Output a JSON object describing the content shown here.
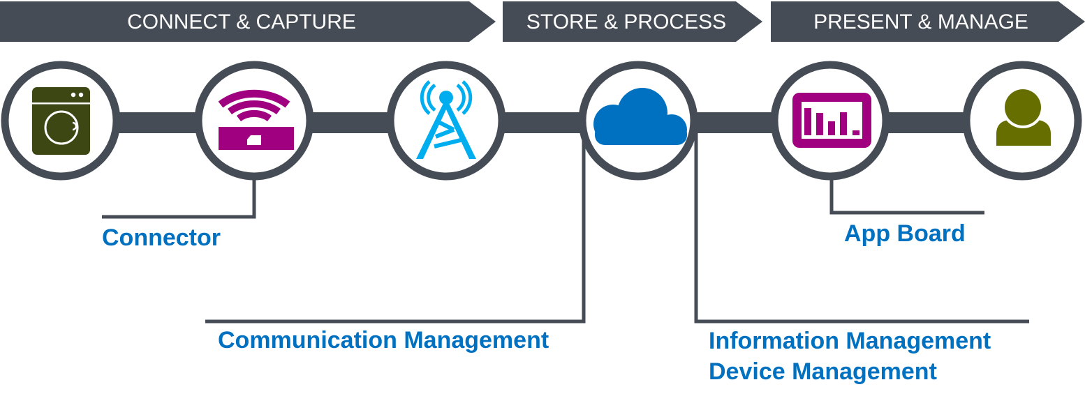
{
  "colors": {
    "banner": "#454c55",
    "connector_line": "#454c55",
    "label_text": "#0070c0",
    "washer_icon": "#3d4714",
    "router_icon": "#a0007f",
    "tower_icon": "#00aeef",
    "cloud_icon": "#0071c1",
    "dashboard_icon": "#a0007f",
    "user_icon": "#666e00"
  },
  "stages": [
    {
      "label": "CONNECT & CAPTURE"
    },
    {
      "label": "STORE & PROCESS"
    },
    {
      "label": "PRESENT & MANAGE"
    }
  ],
  "nodes": [
    {
      "icon": "washing-machine-icon"
    },
    {
      "icon": "wifi-router-icon"
    },
    {
      "icon": "cell-tower-icon"
    },
    {
      "icon": "cloud-icon"
    },
    {
      "icon": "dashboard-chart-icon"
    },
    {
      "icon": "user-icon"
    }
  ],
  "labels": {
    "connector": "Connector",
    "communication_management": "Communication Management",
    "information_management": "Information Management",
    "device_management": "Device Management",
    "app_board": "App Board"
  }
}
